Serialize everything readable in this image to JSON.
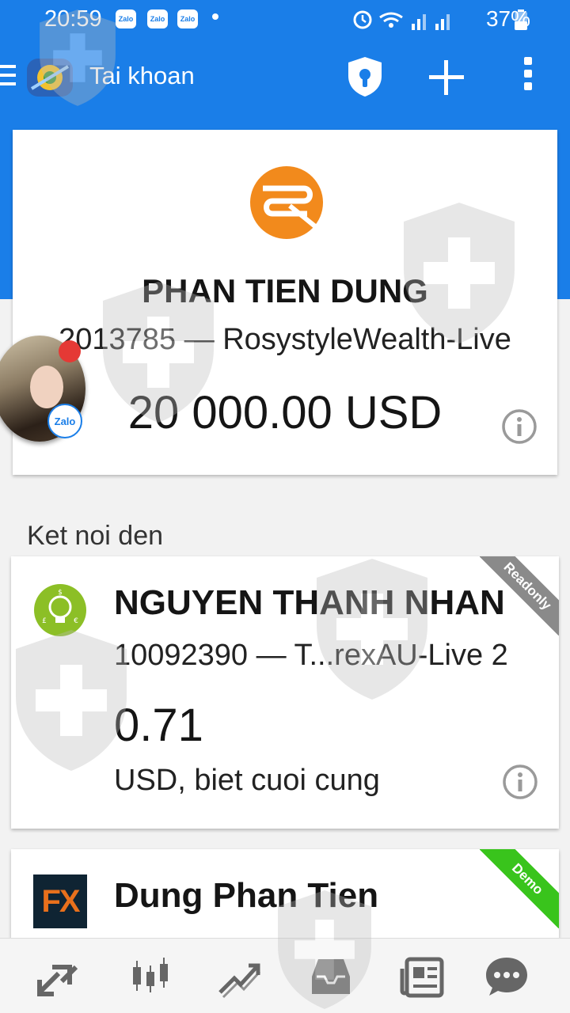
{
  "status_bar": {
    "time": "20:59",
    "notification_icons": [
      "Zalo",
      "Zalo",
      "Zalo"
    ],
    "battery": "37%"
  },
  "app_bar": {
    "title": "Tai khoan"
  },
  "main_account": {
    "name": "PHAN TIEN DUNG",
    "account": "2013785 — RosystyleWealth-Live",
    "balance": "20 000.00 USD"
  },
  "section_label": "Ket noi den",
  "accounts": [
    {
      "name": "NGUYEN THANH NHAN",
      "account": "10092390 — T...rexAU-Live 2",
      "balance": "0.71",
      "sub": "USD, biet cuoi cung",
      "ribbon": "Readonly"
    },
    {
      "name": "Dung Phan Tien",
      "ribbon": "Demo",
      "logo_text": "FX"
    }
  ],
  "chat_head": {
    "badge": "Zalo"
  },
  "colors": {
    "primary": "#1a7ee8",
    "readonly_ribbon": "#8a8a8a",
    "demo_ribbon": "#39c41c",
    "brand_orange": "#f28a1c"
  },
  "bottom_nav": [
    "quotes-icon",
    "chart-candles-icon",
    "trade-icon",
    "history-icon",
    "news-icon",
    "chat-icon"
  ]
}
